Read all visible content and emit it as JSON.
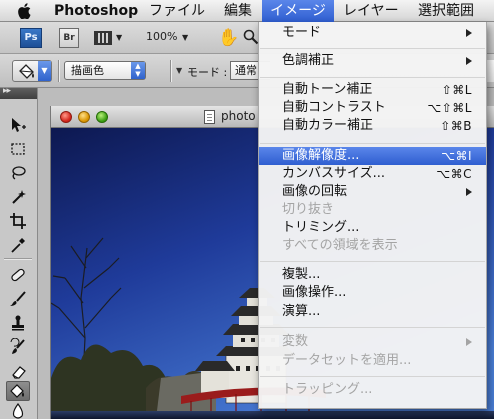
{
  "menubar": {
    "app_name": "Photoshop",
    "file": "ファイル",
    "edit": "編集",
    "image": "イメージ",
    "layer": "レイヤー",
    "select": "選択範囲"
  },
  "appbar": {
    "ps_label": "Ps",
    "br_label": "Br",
    "zoom_level": "100%"
  },
  "options": {
    "fill_source": "描画色",
    "mode_label": "モード :",
    "mode_value": "通常"
  },
  "document": {
    "title": "photo"
  },
  "image_menu": {
    "items": [
      {
        "label": "モード",
        "shortcut": "",
        "submenu": true,
        "enabled": true,
        "highlighted": false
      },
      {
        "label": "色調補正",
        "shortcut": "",
        "submenu": true,
        "enabled": true,
        "highlighted": false
      },
      {
        "label": "自動トーン補正",
        "shortcut": "⇧⌘L",
        "submenu": false,
        "enabled": true,
        "highlighted": false
      },
      {
        "label": "自動コントラスト",
        "shortcut": "⌥⇧⌘L",
        "submenu": false,
        "enabled": true,
        "highlighted": false
      },
      {
        "label": "自動カラー補正",
        "shortcut": "⇧⌘B",
        "submenu": false,
        "enabled": true,
        "highlighted": false
      },
      {
        "label": "画像解像度...",
        "shortcut": "⌥⌘I",
        "submenu": false,
        "enabled": true,
        "highlighted": true
      },
      {
        "label": "カンバスサイズ...",
        "shortcut": "⌥⌘C",
        "submenu": false,
        "enabled": true,
        "highlighted": false
      },
      {
        "label": "画像の回転",
        "shortcut": "",
        "submenu": true,
        "enabled": true,
        "highlighted": false
      },
      {
        "label": "切り抜き",
        "shortcut": "",
        "submenu": false,
        "enabled": false,
        "highlighted": false
      },
      {
        "label": "トリミング...",
        "shortcut": "",
        "submenu": false,
        "enabled": true,
        "highlighted": false
      },
      {
        "label": "すべての領域を表示",
        "shortcut": "",
        "submenu": false,
        "enabled": false,
        "highlighted": false
      },
      {
        "label": "複製...",
        "shortcut": "",
        "submenu": false,
        "enabled": true,
        "highlighted": false
      },
      {
        "label": "画像操作...",
        "shortcut": "",
        "submenu": false,
        "enabled": true,
        "highlighted": false
      },
      {
        "label": "演算...",
        "shortcut": "",
        "submenu": false,
        "enabled": true,
        "highlighted": false
      },
      {
        "label": "変数",
        "shortcut": "",
        "submenu": true,
        "enabled": false,
        "highlighted": false
      },
      {
        "label": "データセットを適用...",
        "shortcut": "",
        "submenu": false,
        "enabled": false,
        "highlighted": false
      },
      {
        "label": "トラッピング...",
        "shortcut": "",
        "submenu": false,
        "enabled": false,
        "highlighted": false
      }
    ]
  },
  "colors": {
    "highlight": "#3b68d6",
    "disabled_text": "#a4a4a4",
    "sky_top": "#0e1a55",
    "sky_bottom": "#3a6fd0"
  }
}
